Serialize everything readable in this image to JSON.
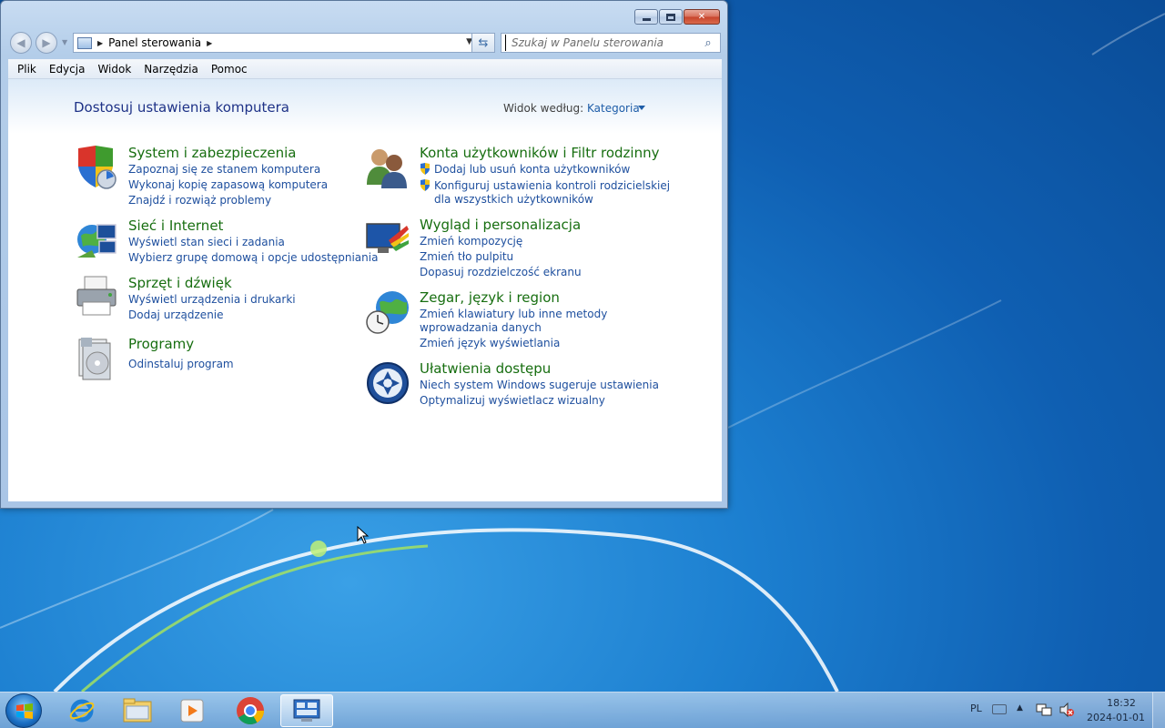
{
  "window": {
    "title": "Panel sterowania",
    "caption_buttons": {
      "minimize": "minimize",
      "maximize": "maximize",
      "close": "close"
    }
  },
  "navbar": {
    "address_path": "Panel sterowania",
    "search_placeholder": "Szukaj w Panelu sterowania"
  },
  "menubar": {
    "items": [
      "Plik",
      "Edycja",
      "Widok",
      "Narzędzia",
      "Pomoc"
    ]
  },
  "content": {
    "title": "Dostosuj ustawienia komputera",
    "view_by_label": "Widok według:",
    "view_by_value": "Kategoria",
    "left_categories": [
      {
        "title": "System i zabezpieczenia",
        "icon": "shield-icon",
        "links": [
          "Zapoznaj się ze stanem komputera",
          "Wykonaj kopię zapasową komputera",
          "Znajdź i rozwiąż problemy"
        ]
      },
      {
        "title": "Sieć i Internet",
        "icon": "network-icon",
        "links": [
          "Wyświetl stan sieci i zadania",
          "Wybierz grupę domową i opcje udostępniania"
        ]
      },
      {
        "title": "Sprzęt i dźwięk",
        "icon": "printer-icon",
        "links": [
          "Wyświetl urządzenia i drukarki",
          "Dodaj urządzenie"
        ]
      },
      {
        "title": "Programy",
        "icon": "programs-icon",
        "links": [
          "Odinstaluj program"
        ]
      }
    ],
    "right_categories": [
      {
        "title": "Konta użytkowników i Filtr rodzinny",
        "icon": "users-icon",
        "links": [
          "Dodaj lub usuń konta użytkowników",
          "Konfiguruj ustawienia kontroli rodzicielskiej",
          "dla wszystkich użytkowników"
        ]
      },
      {
        "title": "Wygląd i personalizacja",
        "icon": "personalization-icon",
        "links": [
          "Zmień kompozycję",
          "Zmień tło pulpitu",
          "Dopasuj rozdzielczość ekranu"
        ]
      },
      {
        "title": "Zegar, język i region",
        "icon": "clock-globe-icon",
        "links": [
          "Zmień klawiatury lub inne metody",
          "wprowadzania danych",
          "Zmień język wyświetlania"
        ]
      },
      {
        "title": "Ułatwienia dostępu",
        "icon": "accessibility-icon",
        "links": [
          "Niech system Windows sugeruje ustawienia",
          "Optymalizuj wyświetlacz wizualny"
        ]
      }
    ]
  },
  "taskbar": {
    "apps": [
      "internet-explorer-icon",
      "file-explorer-icon",
      "media-player-icon",
      "chrome-icon",
      "control-panel-icon"
    ],
    "tray": {
      "language": "PL",
      "time": "18:32",
      "date": "2024-01-01"
    }
  },
  "colors": {
    "category_title": "#176e10",
    "link": "#1e4f9e",
    "page_title": "#1e3287"
  }
}
